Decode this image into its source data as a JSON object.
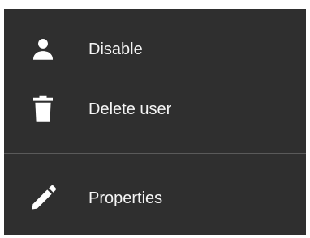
{
  "menu": {
    "items": [
      {
        "label": "Disable",
        "icon": "person-icon"
      },
      {
        "label": "Delete user",
        "icon": "trash-icon"
      },
      {
        "label": "Properties",
        "icon": "pencil-icon"
      }
    ]
  },
  "colors": {
    "menu_background": "#2f2f2f",
    "text": "#f5f5f5",
    "divider": "#5a5a5a"
  }
}
